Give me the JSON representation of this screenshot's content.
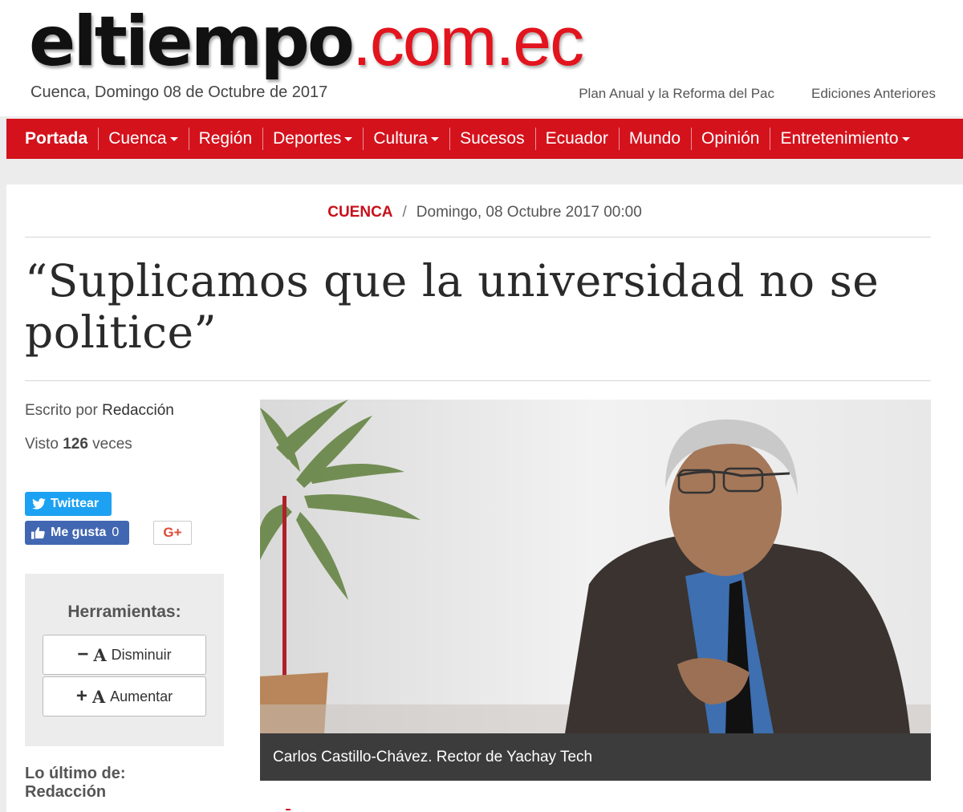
{
  "logo": {
    "part1": "eltiempo",
    "part2": ".com.ec"
  },
  "header": {
    "date": "Cuenca, Domingo 08 de Octubre de 2017",
    "links": [
      "Plan Anual y la Reforma del Pac",
      "Ediciones Anteriores"
    ]
  },
  "nav": {
    "items": [
      {
        "label": "Portada",
        "dropdown": false
      },
      {
        "label": "Cuenca",
        "dropdown": true
      },
      {
        "label": "Región",
        "dropdown": false
      },
      {
        "label": "Deportes",
        "dropdown": true
      },
      {
        "label": "Cultura",
        "dropdown": true
      },
      {
        "label": "Sucesos",
        "dropdown": false
      },
      {
        "label": "Ecuador",
        "dropdown": false
      },
      {
        "label": "Mundo",
        "dropdown": false
      },
      {
        "label": "Opinión",
        "dropdown": false
      },
      {
        "label": "Entretenimiento",
        "dropdown": true
      }
    ]
  },
  "article": {
    "category": "CUENCA",
    "separator": "/",
    "date": "Domingo, 08 Octubre 2017 00:00",
    "title": "“Suplicamos que la universidad no se politice”",
    "author_prefix": "Escrito por",
    "author": "Redacción",
    "views_prefix": "Visto",
    "views_count": "126",
    "views_suffix": "veces"
  },
  "social": {
    "twitter_label": "Twittear",
    "facebook_label": "Me gusta",
    "facebook_count": "0",
    "gplus_label": "G+"
  },
  "tools": {
    "title": "Herramientas:",
    "decrease": {
      "symbol": "−",
      "letter": "A",
      "label": "Disminuir"
    },
    "increase": {
      "symbol": "+",
      "letter": "A",
      "label": "Aumentar"
    }
  },
  "latest": {
    "line1": "Lo último de:",
    "line2": "Redacción"
  },
  "photo": {
    "caption": "Carlos Castillo-Chávez. Rector de Yachay Tech"
  },
  "colors": {
    "brand_red": "#d4121c",
    "twitter": "#1da1f2",
    "facebook": "#4267b2",
    "gplus": "#dd4b39"
  }
}
